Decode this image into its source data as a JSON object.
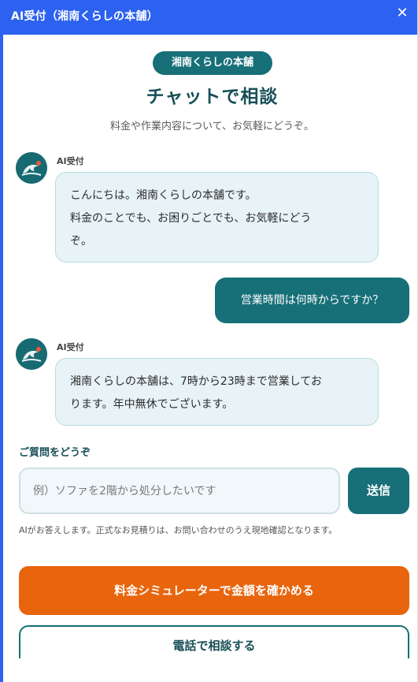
{
  "window": {
    "title": "AI受付（湘南くらしの本舗）",
    "close_symbol": "✕"
  },
  "header": {
    "shop_badge": "湘南くらしの本舗",
    "title": "チャットで相談",
    "subtitle": "料金や作業内容について、お気軽にどうぞ。"
  },
  "messages": [
    {
      "role": "bot",
      "sender": "AI受付",
      "avatar_icon": "wave-icon",
      "text": "こんにちは。湘南くらしの本舗です。\n料金のことでも、お困りごとでも、お気軽にどう\nぞ。"
    },
    {
      "role": "user",
      "text": "営業時間は何時からですか？"
    },
    {
      "role": "bot",
      "sender": "AI受付",
      "avatar_icon": "wave-icon",
      "text": "湘南くらしの本舗は、7時から23時まで営業してお\nります。年中無休でございます。"
    }
  ],
  "composer": {
    "label": "ご質問をどうぞ",
    "placeholder": "例）ソファを2階から処分したいです",
    "value": "",
    "send_label": "送信",
    "notice": "AIがお答えします。正式なお見積りは、お問い合わせのうえ現地確認となります。"
  },
  "actions": {
    "simulator_label": "料金シミュレーターで金額を確かめる",
    "phone_label": "電話で相談する"
  },
  "colors": {
    "titlebar": "#2c62ef",
    "primary": "#176f78",
    "accent_orange": "#e8650d",
    "bot_bubble": "#e7f3f7"
  }
}
